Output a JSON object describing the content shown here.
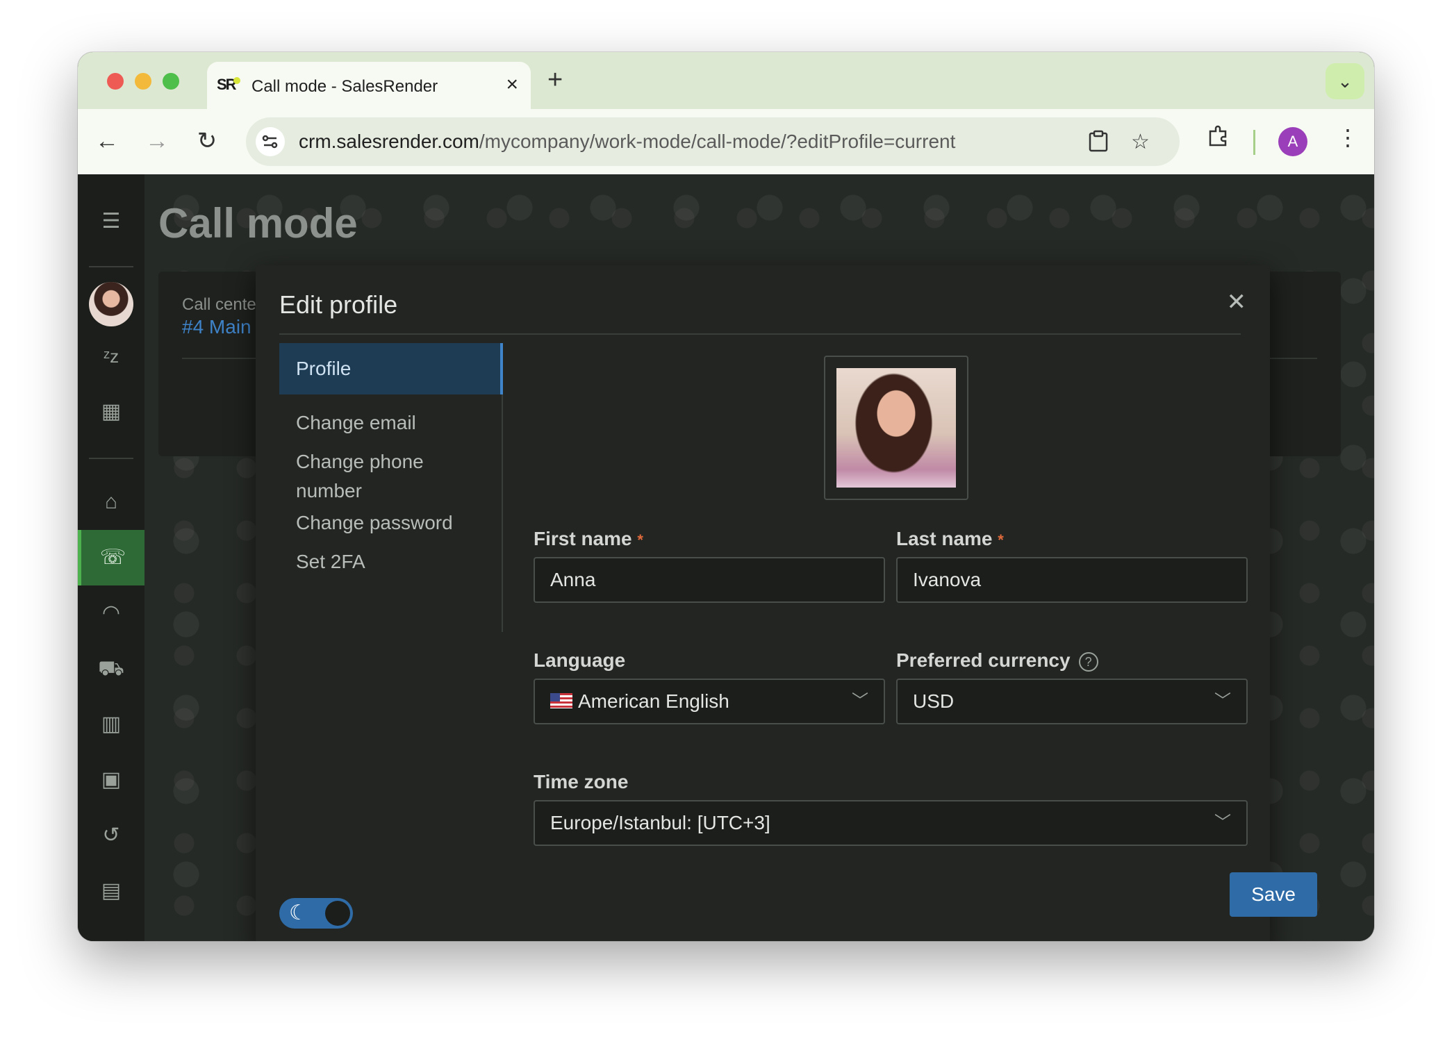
{
  "browser": {
    "tab_title": "Call mode - SalesRender",
    "tab_favicon": "SR",
    "url_domain": "crm.salesrender.com",
    "url_path": "/mycompany/work-mode/call-mode/?editProfile=current",
    "profile_initial": "A",
    "icons": [
      "back-icon",
      "forward-icon",
      "reload-icon",
      "site-info-icon",
      "clipboard-icon",
      "star-icon",
      "extensions-icon",
      "more-icon"
    ]
  },
  "background_page": {
    "title": "Call mode",
    "card_label": "Call center",
    "card_value": "#4 Main"
  },
  "modal": {
    "title": "Edit profile",
    "menu": [
      {
        "label": "Profile"
      },
      {
        "label": "Change email"
      },
      {
        "label": "Change phone number"
      },
      {
        "label": "Change password"
      },
      {
        "label": "Set 2FA"
      }
    ],
    "first_name": {
      "label": "First name",
      "required_mark": "*",
      "value": "Anna"
    },
    "last_name": {
      "label": "Last name",
      "required_mark": "*",
      "value": "Ivanova"
    },
    "language": {
      "label": "Language",
      "value": "American English"
    },
    "currency": {
      "label": "Preferred currency",
      "help": "?",
      "value": "USD"
    },
    "timezone": {
      "label": "Time zone",
      "value": "Europe/Istanbul: [UTC+3]"
    },
    "save_label": "Save",
    "theme": "dark"
  },
  "colors": {
    "accent": "#2f6ca7",
    "active_nav": "#2d6a36",
    "required": "#e06a3c"
  }
}
